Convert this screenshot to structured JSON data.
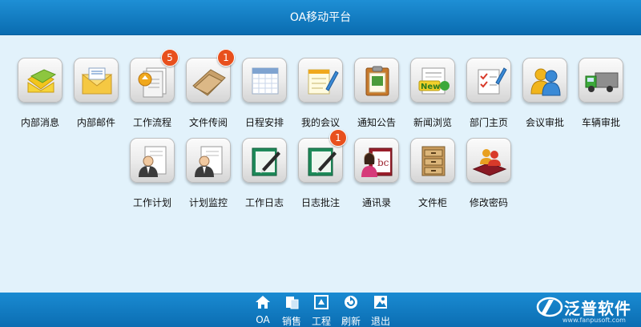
{
  "header": {
    "title": "OA移动平台"
  },
  "apps": [
    {
      "label": "内部消息",
      "icon": "envelope-stack-icon"
    },
    {
      "label": "内部邮件",
      "icon": "mail-icon"
    },
    {
      "label": "工作流程",
      "icon": "document-arrow-icon",
      "badge": "5"
    },
    {
      "label": "文件传阅",
      "icon": "folder-icon",
      "badge": "1"
    },
    {
      "label": "日程安排",
      "icon": "calendar-icon"
    },
    {
      "label": "我的会议",
      "icon": "notepad-pencil-icon"
    },
    {
      "label": "通知公告",
      "icon": "clipboard-icon"
    },
    {
      "label": "新闻浏览",
      "icon": "newspaper-icon"
    },
    {
      "label": "部门主页",
      "icon": "checklist-icon"
    },
    {
      "label": "会议审批",
      "icon": "users-icon"
    },
    {
      "label": "车辆审批",
      "icon": "truck-icon"
    },
    {
      "label": "工作计划",
      "icon": "person-document-icon"
    },
    {
      "label": "计划监控",
      "icon": "person-document-icon"
    },
    {
      "label": "工作日志",
      "icon": "green-book-pen-icon"
    },
    {
      "label": "日志批注",
      "icon": "green-book-pen-icon",
      "badge": "1"
    },
    {
      "label": "通讯录",
      "icon": "address-book-icon"
    },
    {
      "label": "文件柜",
      "icon": "cabinet-icon"
    },
    {
      "label": "修改密码",
      "icon": "password-users-icon"
    }
  ],
  "bottom_nav": [
    {
      "label": "OA",
      "icon": "home-icon"
    },
    {
      "label": "销售",
      "icon": "sales-icon"
    },
    {
      "label": "工程",
      "icon": "engineering-icon"
    },
    {
      "label": "刷新",
      "icon": "refresh-icon"
    },
    {
      "label": "退出",
      "icon": "exit-icon"
    }
  ],
  "brand": {
    "name": "泛普软件",
    "url": "www.fanpusoft.com"
  },
  "colors": {
    "header": "#0f7bc2",
    "background": "#e2f2fb",
    "badge": "#e8501d"
  }
}
